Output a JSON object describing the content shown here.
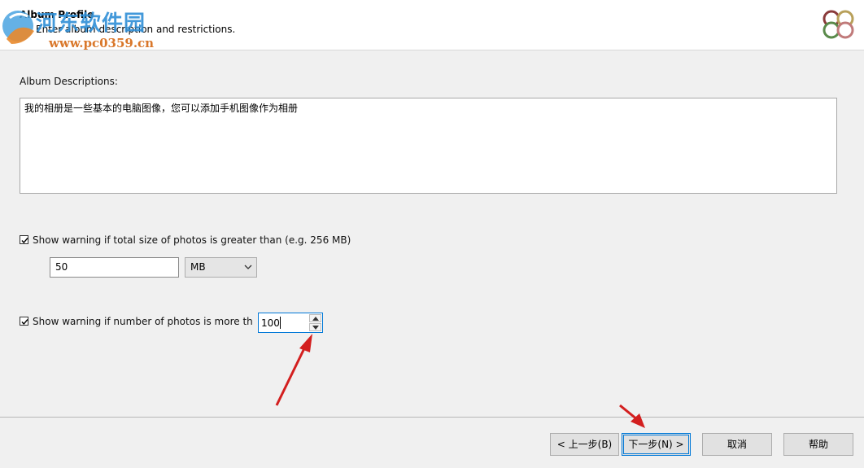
{
  "header": {
    "title": "Album Profile",
    "subtitle": "Enter album description and restrictions."
  },
  "watermark": {
    "name": "河东软件园",
    "url": "www.pc0359.cn"
  },
  "description": {
    "label": "Album Descriptions:",
    "value": "我的相册是一些基本的电脑图像，您可以添加手机图像作为相册"
  },
  "size_warning": {
    "checked": true,
    "label": "Show warning if total size of photos is greater than (e.g. 256 MB)",
    "value": "50",
    "unit": "MB"
  },
  "count_warning": {
    "checked": true,
    "label": "Show warning if number of photos is more tha",
    "value": "100"
  },
  "buttons": {
    "back": "< 上一步(B)",
    "next": "下一步(N) >",
    "cancel": "取消",
    "help": "帮助"
  },
  "colors": {
    "accent": "#0078d7",
    "annotation_arrow": "#d31f1f"
  }
}
